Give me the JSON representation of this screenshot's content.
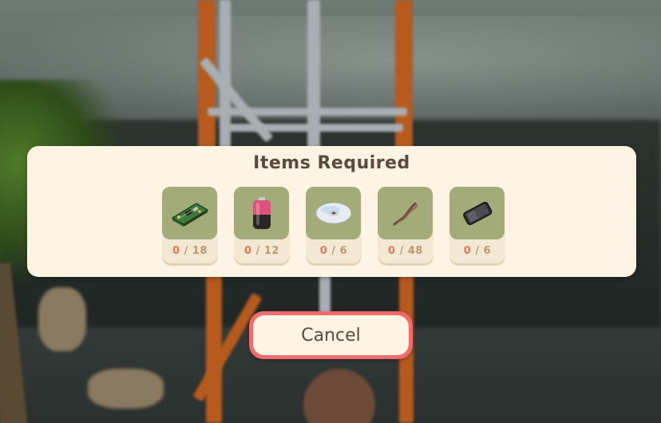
{
  "panel": {
    "title": "Items Required",
    "items": [
      {
        "icon": "circuit-board-icon",
        "have": "0",
        "required": "18"
      },
      {
        "icon": "battery-icon",
        "have": "0",
        "required": "12"
      },
      {
        "icon": "cd-disc-icon",
        "have": "0",
        "required": "6"
      },
      {
        "icon": "wire-cable-icon",
        "have": "0",
        "required": "48"
      },
      {
        "icon": "smartphone-icon",
        "have": "0",
        "required": "6"
      }
    ],
    "separator": " / "
  },
  "cancel": {
    "label": "Cancel"
  },
  "colors": {
    "panel_bg": "#fdf4e3",
    "slot_icon_bg": "#a3ac78",
    "have_count": "#e07b5a",
    "required_count": "#b89a6c",
    "cancel_border": "#f06a6e",
    "text": "#5a4a3a"
  }
}
